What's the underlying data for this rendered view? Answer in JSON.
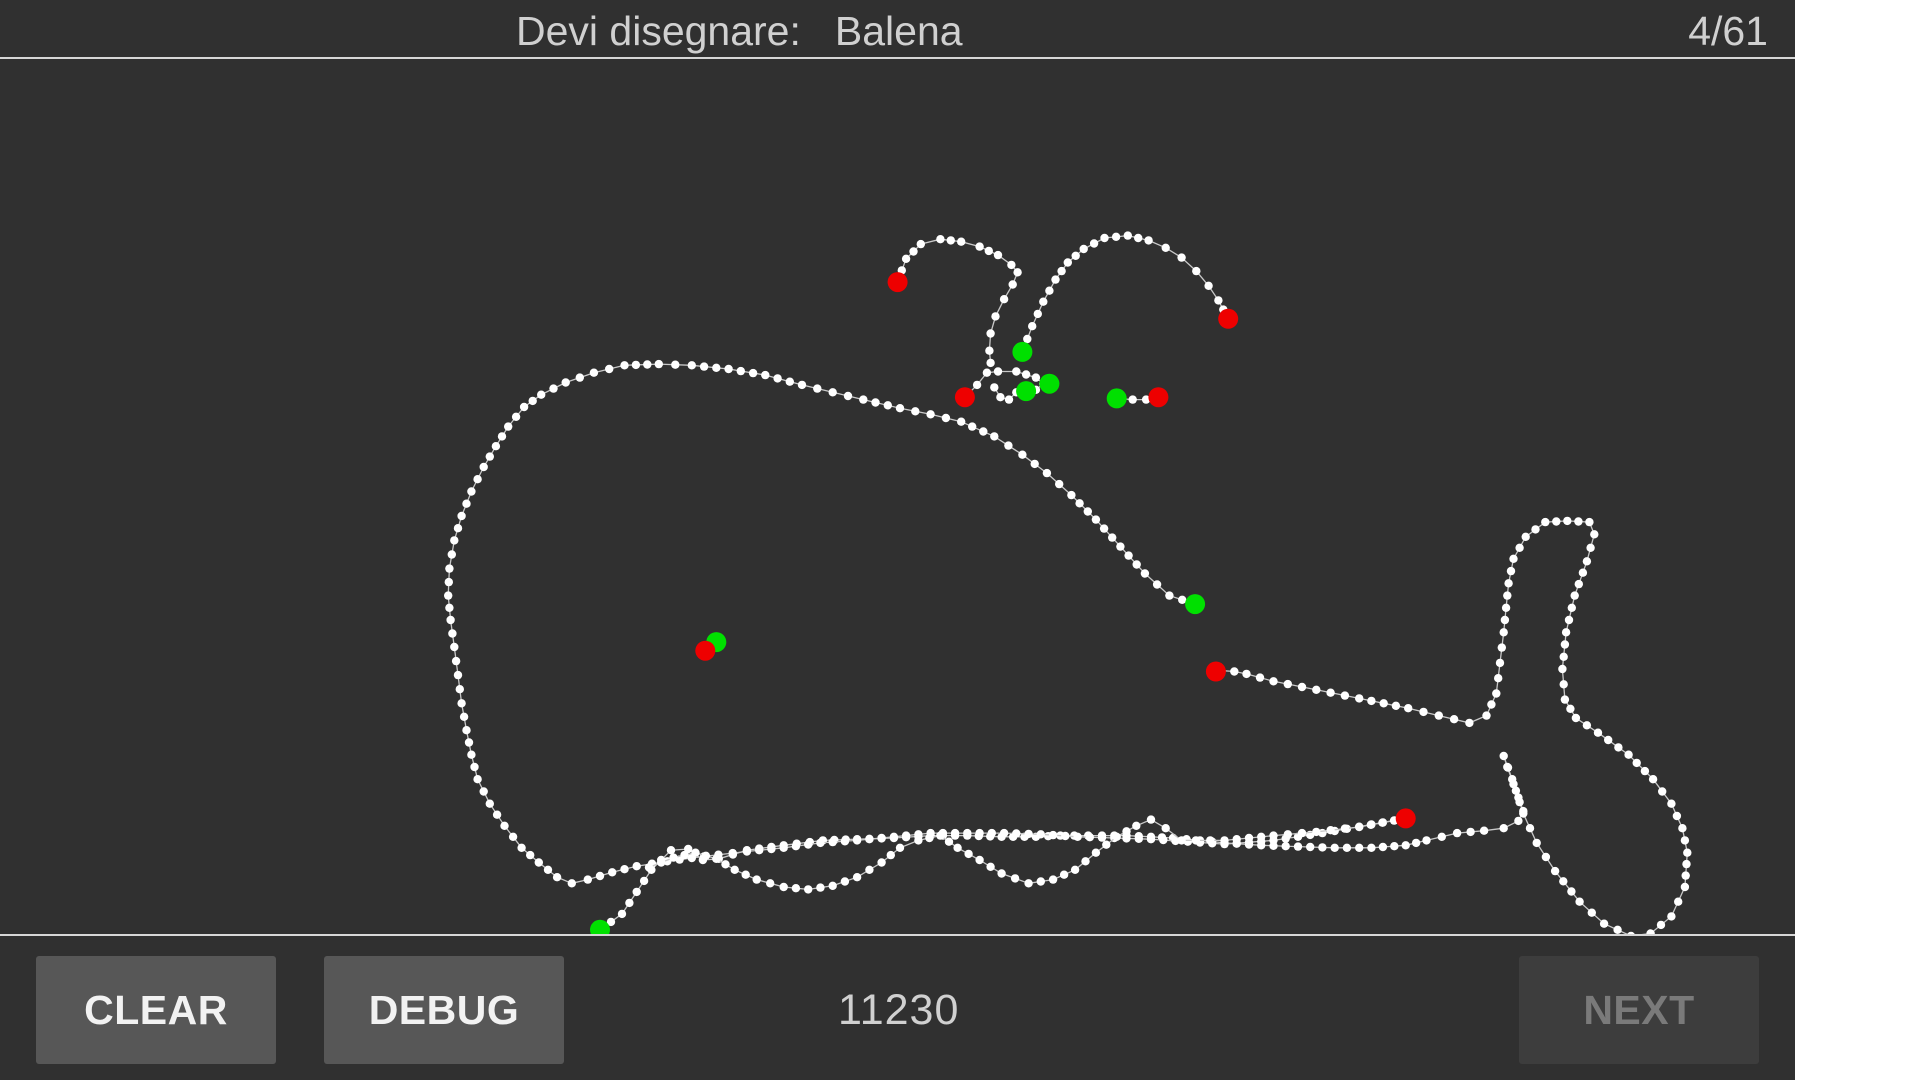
{
  "header": {
    "prompt_label": "Devi disegnare:",
    "target_word": "Balena",
    "progress": "4/61"
  },
  "canvas": {
    "colors": {
      "background": "#303030",
      "stroke_point": "#ffffff",
      "stroke_line": "#c8c8c8",
      "start_marker": "#00e000",
      "end_marker": "#ee0000"
    },
    "stroke_count": 11
  },
  "footer": {
    "clear_label": "CLEAR",
    "debug_label": "DEBUG",
    "score": "11230",
    "next_label": "NEXT",
    "next_enabled": false
  }
}
